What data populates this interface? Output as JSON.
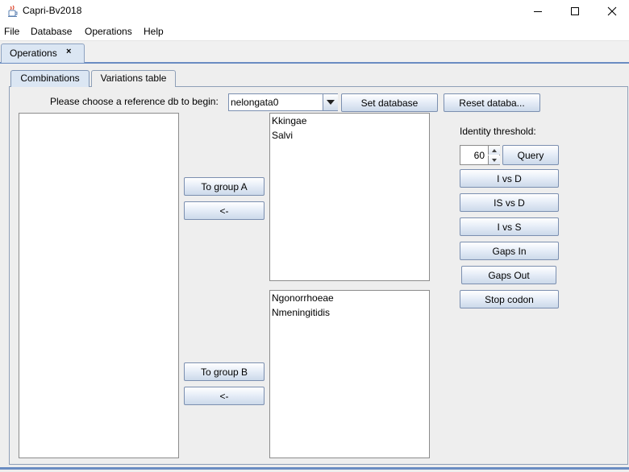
{
  "window": {
    "title": "Capri-Bv2018"
  },
  "menu": {
    "items": [
      "File",
      "Database",
      "Operations",
      "Help"
    ]
  },
  "outer_tab": {
    "label": "Operations",
    "close_glyph": "×"
  },
  "inner_tabs": [
    "Combinations",
    "Variations table"
  ],
  "reference": {
    "prompt": "Please choose a reference db to begin:",
    "selected_db": "nelongata0",
    "set_button": "Set database",
    "reset_button": "Reset databa..."
  },
  "source_list": {
    "items": []
  },
  "group_a": {
    "add_button": "To group A",
    "remove_button": "<-",
    "items": [
      "Kkingae",
      "Salvi"
    ]
  },
  "group_b": {
    "add_button": "To group B",
    "remove_button": "<-",
    "items": [
      "Ngonorrhoeae",
      "Nmeningitidis"
    ]
  },
  "analysis": {
    "identity_label": "Identity threshold:",
    "threshold_value": "60",
    "buttons": [
      "Query",
      "I vs D",
      "IS vs D",
      "I vs S",
      "Gaps In",
      "Gaps Out",
      "Stop codon"
    ]
  },
  "icons": {
    "app": "java-cup-icon",
    "minimize": "minimize-icon",
    "maximize": "maximize-icon",
    "close": "close-icon",
    "dropdown": "triangle-down-icon"
  },
  "colors": {
    "tab_accent": "#6a8cc2",
    "button_top": "#ffffff",
    "button_bottom": "#ccd9ea"
  }
}
